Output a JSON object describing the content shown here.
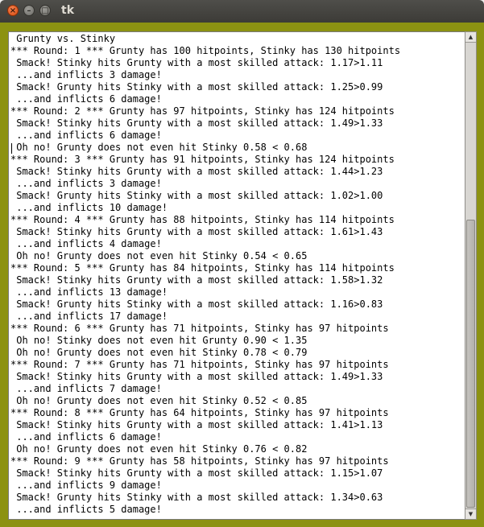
{
  "window": {
    "title": "tk",
    "close_glyph": "×",
    "minimize_glyph": "–",
    "maximize_glyph": "□"
  },
  "scrollbar": {
    "up_glyph": "▲",
    "down_glyph": "▼",
    "thumb_fraction": 0.62
  },
  "colors": {
    "frame_background": "#8c9212",
    "titlebar": "#3c3b37",
    "close_button": "#e05a1b"
  },
  "log_lines": [
    " Grunty vs. Stinky",
    "*** Round: 1 *** Grunty has 100 hitpoints, Stinky has 130 hitpoints",
    " Smack! Stinky hits Grunty with a most skilled attack: 1.17>1.11",
    " ...and inflicts 3 damage!",
    " Smack! Grunty hits Stinky with a most skilled attack: 1.25>0.99",
    " ...and inflicts 6 damage!",
    "*** Round: 2 *** Grunty has 97 hitpoints, Stinky has 124 hitpoints",
    " Smack! Stinky hits Grunty with a most skilled attack: 1.49>1.33",
    " ...and inflicts 6 damage!",
    " Oh no! Grunty does not even hit Stinky 0.58 < 0.68",
    "*** Round: 3 *** Grunty has 91 hitpoints, Stinky has 124 hitpoints",
    " Smack! Stinky hits Grunty with a most skilled attack: 1.44>1.23",
    " ...and inflicts 3 damage!",
    " Smack! Grunty hits Stinky with a most skilled attack: 1.02>1.00",
    " ...and inflicts 10 damage!",
    "*** Round: 4 *** Grunty has 88 hitpoints, Stinky has 114 hitpoints",
    " Smack! Stinky hits Grunty with a most skilled attack: 1.61>1.43",
    " ...and inflicts 4 damage!",
    " Oh no! Grunty does not even hit Stinky 0.54 < 0.65",
    "*** Round: 5 *** Grunty has 84 hitpoints, Stinky has 114 hitpoints",
    " Smack! Stinky hits Grunty with a most skilled attack: 1.58>1.32",
    " ...and inflicts 13 damage!",
    " Smack! Grunty hits Stinky with a most skilled attack: 1.16>0.83",
    " ...and inflicts 17 damage!",
    "*** Round: 6 *** Grunty has 71 hitpoints, Stinky has 97 hitpoints",
    " Oh no! Stinky does not even hit Grunty 0.90 < 1.35",
    " Oh no! Grunty does not even hit Stinky 0.78 < 0.79",
    "*** Round: 7 *** Grunty has 71 hitpoints, Stinky has 97 hitpoints",
    " Smack! Stinky hits Grunty with a most skilled attack: 1.49>1.33",
    " ...and inflicts 7 damage!",
    " Oh no! Grunty does not even hit Stinky 0.52 < 0.85",
    "*** Round: 8 *** Grunty has 64 hitpoints, Stinky has 97 hitpoints",
    " Smack! Stinky hits Grunty with a most skilled attack: 1.41>1.13",
    " ...and inflicts 6 damage!",
    " Oh no! Grunty does not even hit Stinky 0.76 < 0.82",
    "*** Round: 9 *** Grunty has 58 hitpoints, Stinky has 97 hitpoints",
    " Smack! Stinky hits Grunty with a most skilled attack: 1.15>1.07",
    " ...and inflicts 9 damage!",
    " Smack! Grunty hits Stinky with a most skilled attack: 1.34>0.63",
    " ...and inflicts 5 damage!"
  ]
}
